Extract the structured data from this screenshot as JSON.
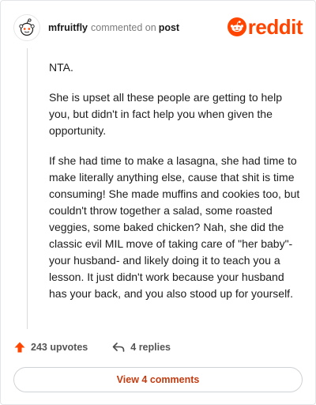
{
  "header": {
    "username": "mfruitfly",
    "commented_text": "commented on",
    "post_link": "post",
    "logo_text": "reddit"
  },
  "comment": {
    "paragraphs": [
      "NTA.",
      "She is upset all these people are getting to help you, but didn't in fact help you when given the opportunity.",
      "If she had time to make a lasagna, she had time to make literally anything else, cause that shit is time consuming! She made muffins and cookies too, but couldn't throw together a salad, some roasted veggies, some baked chicken? Nah, she did the classic evil MIL move of taking care of \"her baby\"- your husband- and likely doing it to teach you a lesson. It just didn't work because your husband has your back, and you also stood up for yourself."
    ]
  },
  "actions": {
    "upvotes": "243 upvotes",
    "replies": "4 replies"
  },
  "footer": {
    "view_comments": "View 4 comments"
  },
  "colors": {
    "brand": "#ff4500",
    "link": "#c23c11"
  },
  "icons": [
    "snoo-avatar-icon",
    "reddit-logo-icon",
    "upvote-arrow-icon",
    "reply-arrow-icon"
  ]
}
